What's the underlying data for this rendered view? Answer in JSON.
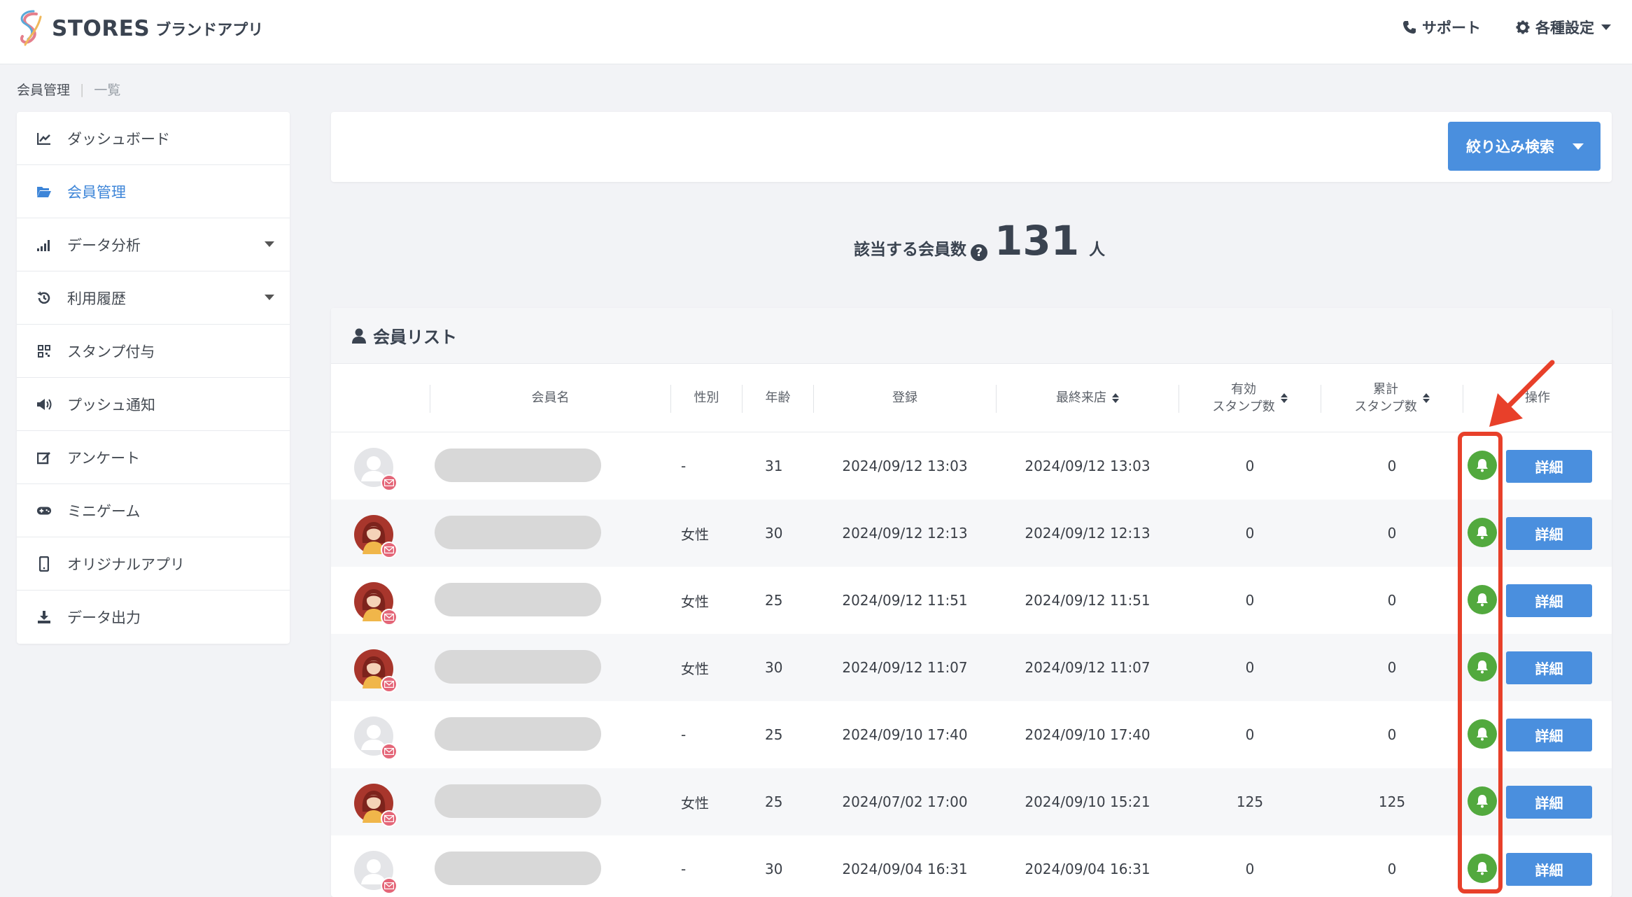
{
  "header": {
    "logo_text": "STORES",
    "logo_sub": "ブランドアプリ",
    "support_label": "サポート",
    "settings_label": "各種設定"
  },
  "breadcrumb": {
    "parent": "会員管理",
    "current": "一覧"
  },
  "sidebar": {
    "items": [
      {
        "label": "ダッシュボード",
        "icon": "chart-line-icon",
        "active": false,
        "expandable": false
      },
      {
        "label": "会員管理",
        "icon": "folder-open-icon",
        "active": true,
        "expandable": false
      },
      {
        "label": "データ分析",
        "icon": "signal-bars-icon",
        "active": false,
        "expandable": true
      },
      {
        "label": "利用履歴",
        "icon": "history-icon",
        "active": false,
        "expandable": true
      },
      {
        "label": "スタンプ付与",
        "icon": "qrcode-icon",
        "active": false,
        "expandable": false
      },
      {
        "label": "プッシュ通知",
        "icon": "megaphone-icon",
        "active": false,
        "expandable": false
      },
      {
        "label": "アンケート",
        "icon": "edit-icon",
        "active": false,
        "expandable": false
      },
      {
        "label": "ミニゲーム",
        "icon": "gamepad-icon",
        "active": false,
        "expandable": false
      },
      {
        "label": "オリジナルアプリ",
        "icon": "mobile-icon",
        "active": false,
        "expandable": false
      },
      {
        "label": "データ出力",
        "icon": "download-icon",
        "active": false,
        "expandable": false
      }
    ]
  },
  "filter": {
    "button_label": "絞り込み検索"
  },
  "summary": {
    "label": "該当する会員数",
    "help": "?",
    "count": "131",
    "unit": "人"
  },
  "member_list": {
    "title": "会員リスト",
    "columns": {
      "name": "会員名",
      "gender": "性別",
      "age": "年齢",
      "registered": "登録",
      "last_visit": "最終来店",
      "valid_stamps_1": "有効",
      "valid_stamps_2": "スタンプ数",
      "total_stamps_1": "累計",
      "total_stamps_2": "スタンプ数",
      "actions": "操作"
    },
    "detail_label": "詳細",
    "rows": [
      {
        "avatar": "default",
        "gender": "-",
        "age": "31",
        "registered": "2024/09/12 13:03",
        "last_visit": "2024/09/12 13:03",
        "valid_stamps": "0",
        "total_stamps": "0"
      },
      {
        "avatar": "female",
        "gender": "女性",
        "age": "30",
        "registered": "2024/09/12 12:13",
        "last_visit": "2024/09/12 12:13",
        "valid_stamps": "0",
        "total_stamps": "0"
      },
      {
        "avatar": "female",
        "gender": "女性",
        "age": "25",
        "registered": "2024/09/12 11:51",
        "last_visit": "2024/09/12 11:51",
        "valid_stamps": "0",
        "total_stamps": "0"
      },
      {
        "avatar": "female",
        "gender": "女性",
        "age": "30",
        "registered": "2024/09/12 11:07",
        "last_visit": "2024/09/12 11:07",
        "valid_stamps": "0",
        "total_stamps": "0"
      },
      {
        "avatar": "default",
        "gender": "-",
        "age": "25",
        "registered": "2024/09/10 17:40",
        "last_visit": "2024/09/10 17:40",
        "valid_stamps": "0",
        "total_stamps": "0"
      },
      {
        "avatar": "female",
        "gender": "女性",
        "age": "25",
        "registered": "2024/07/02 17:00",
        "last_visit": "2024/09/10 15:21",
        "valid_stamps": "125",
        "total_stamps": "125"
      },
      {
        "avatar": "default",
        "gender": "-",
        "age": "30",
        "registered": "2024/09/04 16:31",
        "last_visit": "2024/09/04 16:31",
        "valid_stamps": "0",
        "total_stamps": "0"
      }
    ]
  },
  "colors": {
    "accent": "#4a8fde",
    "bell": "#52a93e",
    "annotation": "#e8402a",
    "mail_badge": "#e46678"
  }
}
